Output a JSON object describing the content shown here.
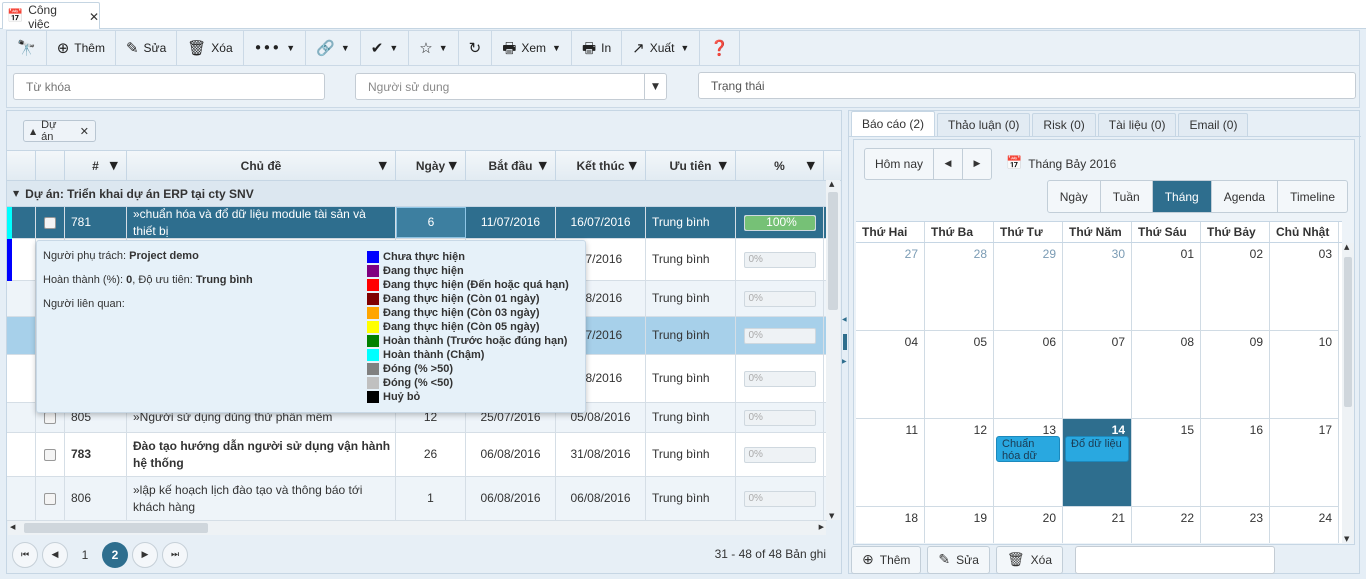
{
  "tab": {
    "title": "Công việc",
    "icon": "calendar-icon"
  },
  "toolbar": {
    "binoculars_icon": "binoculars-icon",
    "add": "Thêm",
    "edit": "Sửa",
    "delete": "Xóa",
    "view": "Xem",
    "print": "In",
    "export": "Xuất"
  },
  "filters": {
    "keyword_placeholder": "Từ khóa",
    "user_placeholder": "Người sử dụng",
    "status_placeholder": "Trạng thái"
  },
  "group_chip": "Dự án",
  "columns": [
    "#",
    "Chủ đề",
    "Ngày",
    "Bắt đầu",
    "Kết thúc",
    "Ưu tiên",
    "%"
  ],
  "group_row": "Dự án: Triển khai dự án ERP tại cty SNV",
  "rows": [
    {
      "id": "781",
      "subject": "»chuẩn hóa và đổ dữ liệu module tài sản và thiết bị",
      "days": "6",
      "start": "11/07/2016",
      "end": "16/07/2016",
      "priority": "Trung bình",
      "pct": "100%",
      "progress": 100
    },
    {
      "id": "",
      "subject": "",
      "days": "",
      "start": "",
      "end": "07/2016",
      "priority": "Trung bình",
      "pct": "0%",
      "progress": 0
    },
    {
      "id": "",
      "subject": "",
      "days": "",
      "start": "",
      "end": "08/2016",
      "priority": "Trung bình",
      "pct": "0%",
      "progress": 0
    },
    {
      "id": "",
      "subject": "",
      "days": "",
      "start": "",
      "end": "07/2016",
      "priority": "Trung bình",
      "pct": "0%",
      "progress": 0
    },
    {
      "id": "",
      "subject": "",
      "days": "",
      "start": "",
      "end": "08/2016",
      "priority": "Trung bình",
      "pct": "0%",
      "progress": 0
    },
    {
      "id": "805",
      "subject": "»Người sử dụng dùng thử phần mềm",
      "days": "12",
      "start": "25/07/2016",
      "end": "05/08/2016",
      "priority": "Trung bình",
      "pct": "0%",
      "progress": 0
    },
    {
      "id": "783",
      "subject": "Đào tạo hướng dẫn người sử dụng vận hành hệ thống",
      "days": "26",
      "start": "06/08/2016",
      "end": "31/08/2016",
      "priority": "Trung bình",
      "pct": "0%",
      "progress": 0
    },
    {
      "id": "806",
      "subject": "»lập kế hoạch lịch đào tạo và thông báo tới khách hàng",
      "days": "1",
      "start": "06/08/2016",
      "end": "06/08/2016",
      "priority": "Trung bình",
      "pct": "0%",
      "progress": 0
    }
  ],
  "popup": {
    "owner_label": "Người phụ trách:",
    "owner_value": "Project demo",
    "complete_label": "Hoàn thành (%):",
    "complete_value": "0",
    "priority_label": ", Độ ưu tiên:",
    "priority_value": "Trung bình",
    "related_label": "Người liên quan:",
    "legend": [
      {
        "label": "Chưa thực hiện",
        "color": "#0000ff"
      },
      {
        "label": "Đang thực hiện",
        "color": "#800080"
      },
      {
        "label": "Đang thực hiện (Đến hoặc quá hạn)",
        "color": "#ff0000"
      },
      {
        "label": "Đang thực hiện (Còn 01 ngày)",
        "color": "#800000"
      },
      {
        "label": "Đang thực hiện (Còn 03 ngày)",
        "color": "#ffa500"
      },
      {
        "label": "Đang thực hiện (Còn 05 ngày)",
        "color": "#ffff00"
      },
      {
        "label": "Hoàn thành (Trước hoặc đúng hạn)",
        "color": "#008000"
      },
      {
        "label": "Hoàn thành (Chậm)",
        "color": "#00ffff"
      },
      {
        "label": "Đóng (% >50)",
        "color": "#808080"
      },
      {
        "label": "Đóng (% <50)",
        "color": "#c0c0c0"
      },
      {
        "label": "Huỷ bỏ",
        "color": "#000000"
      }
    ]
  },
  "pager": {
    "pages": [
      "1",
      "2"
    ],
    "current": "2",
    "summary": "31 - 48 of 48 Bản ghi"
  },
  "right_tabs": [
    "Báo cáo (2)",
    "Thảo luận (0)",
    "Risk (0)",
    "Tài liệu (0)",
    "Email (0)"
  ],
  "scheduler": {
    "today": "Hôm nay",
    "date_label": "Tháng Bảy 2016",
    "views": [
      "Ngày",
      "Tuần",
      "Tháng",
      "Agenda",
      "Timeline"
    ],
    "active_view": "Tháng",
    "weekdays": [
      "Thứ Hai",
      "Thứ Ba",
      "Thứ Tư",
      "Thứ Năm",
      "Thứ Sáu",
      "Thứ Bảy",
      "Chủ Nhật"
    ],
    "weeks": [
      [
        "27",
        "28",
        "29",
        "30",
        "01",
        "02",
        "03"
      ],
      [
        "04",
        "05",
        "06",
        "07",
        "08",
        "09",
        "10"
      ],
      [
        "11",
        "12",
        "13",
        "14",
        "15",
        "16",
        "17"
      ],
      [
        "18",
        "19",
        "20",
        "21",
        "22",
        "23",
        "24"
      ]
    ],
    "today_cell": "14",
    "events": [
      {
        "title": "Chuẩn hóa dữ",
        "day": "13"
      },
      {
        "title": "Đổ dữ liệu",
        "day": "14"
      }
    ]
  },
  "right_buttons": {
    "add": "Thêm",
    "edit": "Sửa",
    "delete": "Xóa"
  }
}
